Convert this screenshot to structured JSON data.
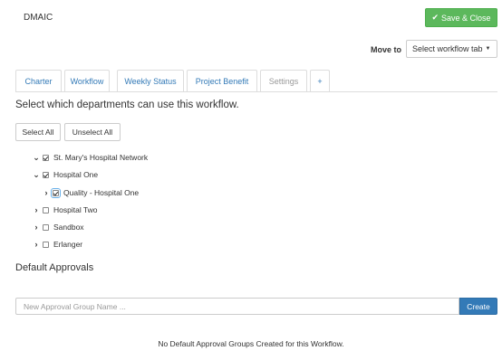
{
  "header": {
    "title": "DMAIC",
    "save_label": "Save & Close",
    "save_icon": "check-icon"
  },
  "move_to": {
    "label": "Move to",
    "select_value": "Select workflow tab"
  },
  "tabs": [
    {
      "label": "Charter"
    },
    {
      "label": "Workflow"
    },
    {
      "label": "Weekly Status"
    },
    {
      "label": "Project Benefit"
    },
    {
      "label": "Settings"
    },
    {
      "label": "+"
    }
  ],
  "departments": {
    "heading": "Select which departments can use this workflow.",
    "select_all": "Select All",
    "unselect_all": "Unselect All",
    "tree": [
      {
        "label": "St. Mary's Hospital Network",
        "expanded": true,
        "checked": true
      },
      {
        "label": "Hospital One",
        "expanded": true,
        "checked": true
      },
      {
        "label": "Quality - Hospital One",
        "expanded": false,
        "checked": true
      },
      {
        "label": "Hospital Two",
        "expanded": false,
        "checked": false
      },
      {
        "label": "Sandbox",
        "expanded": false,
        "checked": false
      },
      {
        "label": "Erlanger",
        "expanded": false,
        "checked": false
      }
    ]
  },
  "approvals": {
    "heading": "Default Approvals",
    "input_placeholder": "New Approval Group Name ...",
    "create_label": "Create",
    "empty_message": "No Default Approval Groups Created for this Workflow."
  },
  "colors": {
    "save": "#5cb85c",
    "create": "#337ab7",
    "link": "#337ab7"
  }
}
